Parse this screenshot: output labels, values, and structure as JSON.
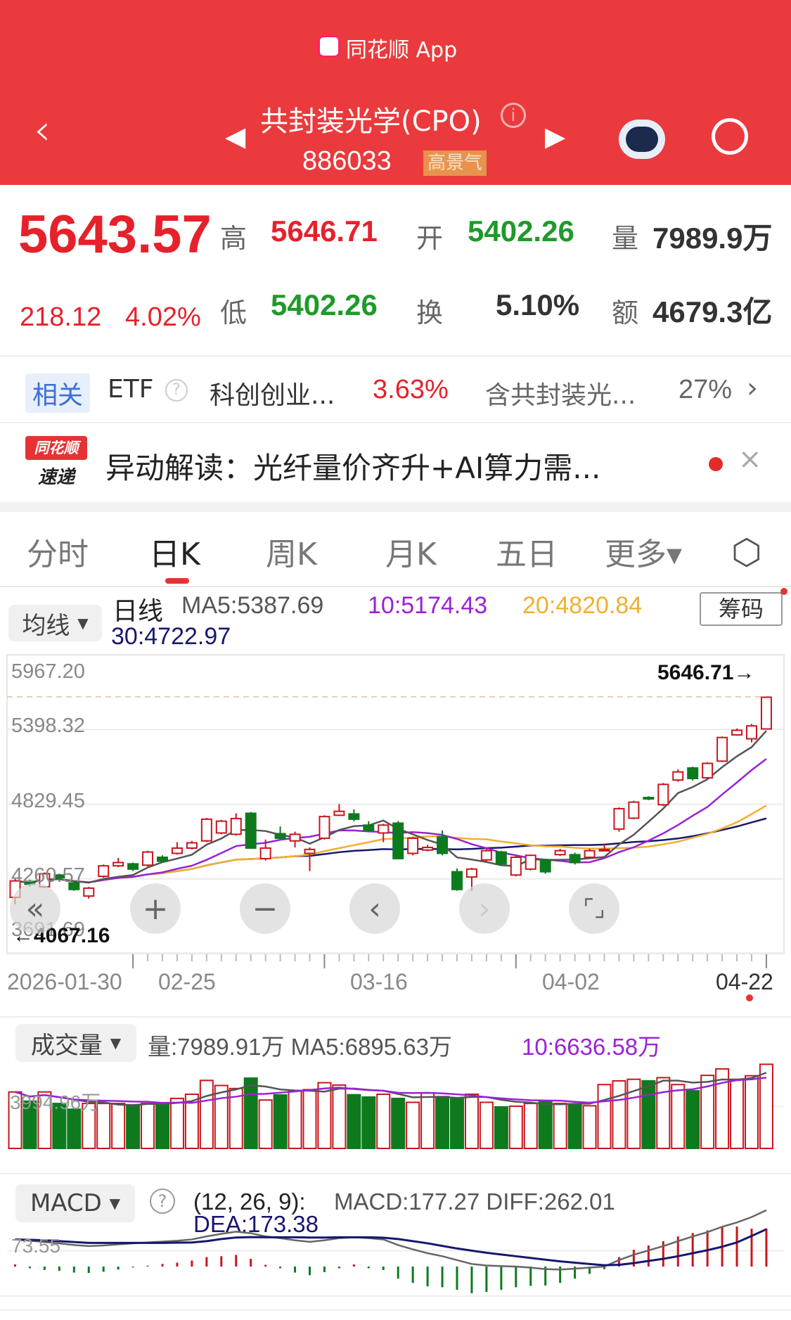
{
  "header": {
    "app_label": "同花顺 App",
    "title": "共封装光学(CPO)",
    "code": "886033",
    "badge": "高景气"
  },
  "quote": {
    "price": "5643.57",
    "change": "218.12",
    "change_pct": "4.02%",
    "high_label": "高",
    "high": "5646.71",
    "open_label": "开",
    "open": "5402.26",
    "vol_label": "量",
    "vol": "7989.9万",
    "low_label": "低",
    "low": "5402.26",
    "turnover_label": "换",
    "turnover": "5.10%",
    "amount_label": "额",
    "amount": "4679.3亿"
  },
  "etf": {
    "tag": "相关",
    "label": "ETF",
    "name": "科创创业...",
    "pct": "3.63%",
    "holding": "含共封装光...",
    "holding_pct": "27%"
  },
  "news": {
    "logo_top": "同花顺",
    "logo_bottom": "速递",
    "text": "异动解读：光纤量价齐升+AI算力需..."
  },
  "tabs": [
    "分时",
    "日K",
    "周K",
    "月K",
    "五日",
    "更多▾"
  ],
  "ma": {
    "select": "均线",
    "kind": "日线",
    "ma5": "MA5:5387.69",
    "ma10": "10:5174.43",
    "ma20": "20:4820.84",
    "ma30": "30:4722.97",
    "chips_button": "筹码"
  },
  "colors": {
    "up": "#c8161d",
    "down": "#0e7a1e",
    "ma5": "#555555",
    "ma10": "#9a22d6",
    "ma20": "#f0b030",
    "ma30": "#17176e"
  },
  "chart_data": {
    "type": "candlestick",
    "y_ticks": [
      "5967.20",
      "5398.32",
      "4829.45",
      "4260.57",
      "3691.69"
    ],
    "ylim": [
      3691.69,
      5967.2
    ],
    "max_label": "5646.71→",
    "min_label": "←4067.16",
    "max": 5646.71,
    "min": 4067.16,
    "dates": [
      "2026-01-30",
      "02-25",
      "03-16",
      "04-02",
      "04-22"
    ],
    "open": [
      4120,
      4240,
      4200,
      4290,
      4230,
      4130,
      4280,
      4360,
      4375,
      4365,
      4425,
      4455,
      4495,
      4550,
      4610,
      4600,
      4760,
      4415,
      4605,
      4550,
      4455,
      4570,
      4745,
      4755,
      4670,
      4610,
      4685,
      4455,
      4480,
      4580,
      4315,
      4275,
      4405,
      4465,
      4290,
      4335,
      4405,
      4445,
      4445,
      4425,
      4475,
      4640,
      4723,
      4880,
      4825,
      5013,
      5105,
      5030,
      5157,
      5357,
      5327,
      5402.26
    ],
    "close": [
      4245,
      4220,
      4300,
      4270,
      4180,
      4190,
      4360,
      4385,
      4335,
      4465,
      4395,
      4495,
      4535,
      4715,
      4700,
      4720,
      4495,
      4495,
      4570,
      4600,
      4485,
      4735,
      4775,
      4715,
      4630,
      4670,
      4415,
      4570,
      4500,
      4455,
      4180,
      4335,
      4475,
      4375,
      4425,
      4440,
      4315,
      4475,
      4385,
      4475,
      4485,
      4795,
      4845,
      4875,
      4980,
      5075,
      5025,
      5140,
      5337,
      5392,
      5425.45,
      5643.57
    ],
    "high": [
      4260,
      4255,
      4310,
      4300,
      4240,
      4200,
      4370,
      4420,
      4385,
      4475,
      4440,
      4540,
      4550,
      4725,
      4710,
      4760,
      4770,
      4560,
      4660,
      4620,
      4500,
      4745,
      4830,
      4790,
      4700,
      4680,
      4700,
      4580,
      4520,
      4630,
      4340,
      4345,
      4490,
      4475,
      4435,
      4445,
      4410,
      4490,
      4460,
      4490,
      4530,
      4805,
      4855,
      4890,
      4990,
      5095,
      5115,
      5150,
      5345,
      5405,
      5440,
      5646.71
    ],
    "low": [
      4067.16,
      4200,
      4190,
      4260,
      4170,
      4110,
      4270,
      4350,
      4320,
      4355,
      4385,
      4445,
      4485,
      4540,
      4600,
      4590,
      4490,
      4400,
      4560,
      4500,
      4320,
      4560,
      4740,
      4700,
      4620,
      4540,
      4410,
      4440,
      4470,
      4440,
      4170,
      4170,
      4395,
      4365,
      4280,
      4325,
      4300,
      4435,
      4370,
      4415,
      4470,
      4620,
      4715,
      4860,
      4815,
      5000,
      5010,
      5020,
      5150,
      5350,
      5300,
      5400
    ],
    "volume_select": "成交量",
    "volume_text": "量:7989.91万 MA5:6895.63万",
    "volume_ma10": "10:6636.58万",
    "volume_tick": "3994.96万",
    "volume": [
      5363,
      4488,
      5363,
      4269,
      3721,
      4269,
      4269,
      4269,
      4050,
      4269,
      4269,
      4750,
      5144,
      6458,
      5976,
      5691,
      6676,
      4597,
      5078,
      5472,
      5582,
      6239,
      6020,
      5100,
      4880,
      5144,
      4750,
      4378,
      5254,
      4925,
      4706,
      5144,
      4378,
      3940,
      4006,
      4269,
      4488,
      4269,
      4159,
      4050,
      6064,
      6414,
      6567,
      6414,
      6720,
      6064,
      5472,
      6939,
      7552,
      6567,
      6900,
      7989.91
    ],
    "macd_select": "MACD",
    "macd_params": "(12, 26, 9):",
    "macd_text": "MACD:177.27  DIFF:262.01",
    "dea_text": "DEA:173.38",
    "macd_tick": "73.55",
    "diff": [
      126,
      120,
      114,
      108,
      100,
      95,
      98,
      103,
      108,
      112,
      116,
      120,
      126,
      140,
      152,
      162,
      155,
      140,
      132,
      122,
      115,
      122,
      132,
      136,
      132,
      126,
      100,
      80,
      62,
      48,
      30,
      12,
      5,
      2,
      0,
      -5,
      -12,
      -14,
      -10,
      -5,
      0,
      30,
      55,
      75,
      95,
      118,
      140,
      160,
      185,
      205,
      230,
      262.01
    ],
    "dea": [
      126,
      124,
      122,
      118,
      114,
      110,
      110,
      110,
      110,
      110,
      110,
      111,
      112,
      118,
      128,
      135,
      137,
      136,
      136,
      136,
      135,
      135,
      136,
      136,
      136,
      134,
      128,
      118,
      108,
      96,
      84,
      74,
      64,
      56,
      48,
      40,
      32,
      24,
      18,
      12,
      6,
      8,
      16,
      26,
      36,
      48,
      62,
      76,
      92,
      112,
      142,
      173.38
    ]
  }
}
